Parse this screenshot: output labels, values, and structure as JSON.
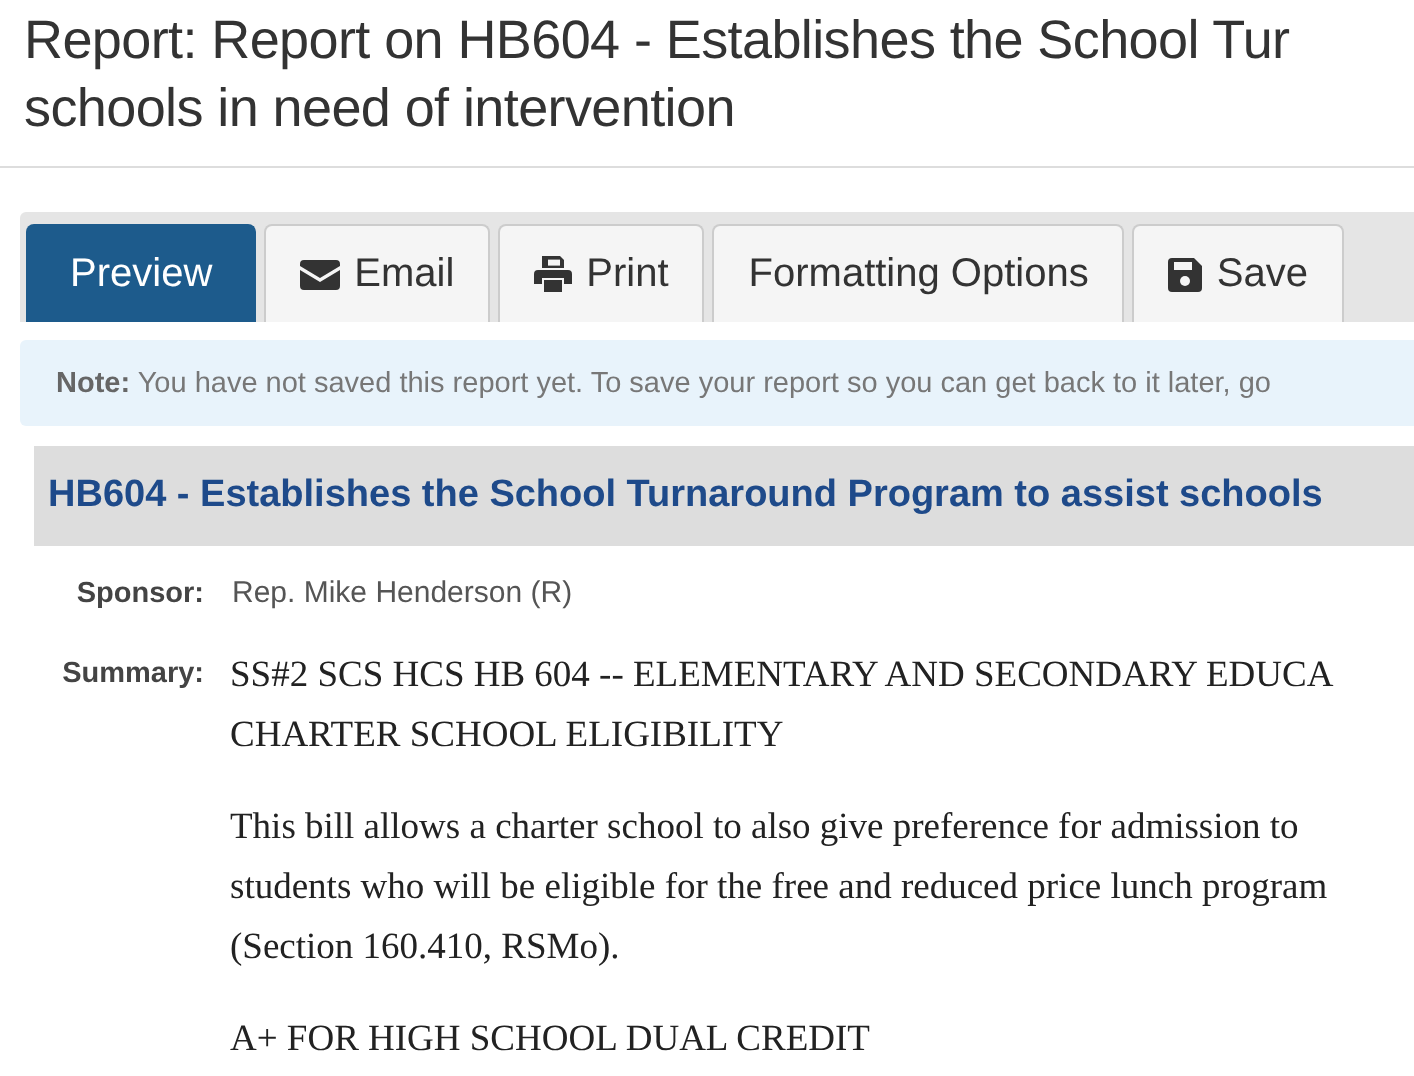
{
  "page_title": [
    "Report: Report on HB604 - Establishes the School Tur",
    "schools in need of intervention"
  ],
  "tabs": [
    {
      "label": "Preview",
      "kind": "plain",
      "selected": true
    },
    {
      "label": "Email",
      "kind": "email",
      "selected": false
    },
    {
      "label": "Print",
      "kind": "print",
      "selected": false
    },
    {
      "label": "Formatting Options",
      "kind": "plain",
      "selected": false
    },
    {
      "label": "Save",
      "kind": "save",
      "selected": false
    }
  ],
  "note": {
    "label": "Note:",
    "text": "You have not saved this report yet. To save your report so you can get back to it later, go"
  },
  "bill": {
    "heading": "HB604 - Establishes the School Turnaround Program to assist schools",
    "sponsor_label": "Sponsor:",
    "sponsor": "Rep. Mike Henderson (R)",
    "summary_label": "Summary:",
    "summary": [
      "SS#2 SCS HCS HB 604 -- ELEMENTARY AND SECONDARY EDUCA\nCHARTER SCHOOL ELIGIBILITY",
      "This bill allows a charter school to also give preference for admission to students who will be eligible for the free and reduced price lunch program (Section 160.410, RSMo).",
      "A+ FOR HIGH SCHOOL DUAL CREDIT"
    ]
  }
}
